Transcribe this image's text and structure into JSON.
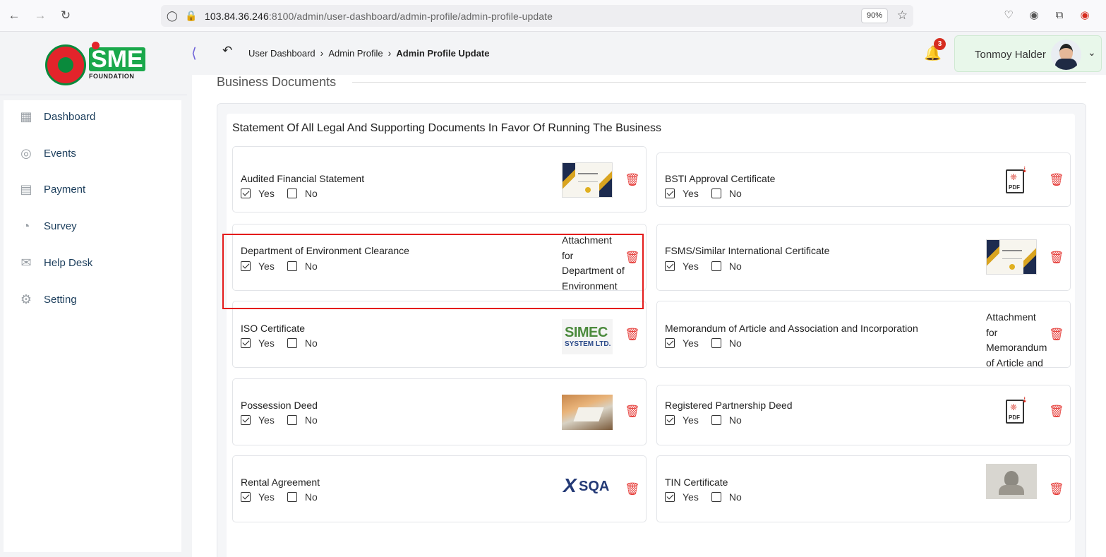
{
  "browser": {
    "url_host": "103.84.36.246",
    "url_rest": ":8100/admin/user-dashboard/admin-profile/admin-profile-update",
    "zoom": "90%"
  },
  "sidebar": {
    "logo_text": "SME",
    "logo_sub": "FOUNDATION",
    "items": [
      {
        "label": "Dashboard",
        "icon": "grid-icon"
      },
      {
        "label": "Events",
        "icon": "events-icon"
      },
      {
        "label": "Payment",
        "icon": "payment-icon"
      },
      {
        "label": "Survey",
        "icon": "pie-chart-icon"
      },
      {
        "label": "Help Desk",
        "icon": "mail-icon"
      },
      {
        "label": "Setting",
        "icon": "gear-icon"
      }
    ]
  },
  "header": {
    "breadcrumb": [
      "User Dashboard",
      "Admin Profile",
      "Admin Profile Update"
    ],
    "notification_count": "3",
    "user_name": "Tonmoy Halder"
  },
  "main": {
    "section_title": "Business Documents",
    "card_title": "Statement Of All Legal And Supporting Documents In Favor Of Running The Business",
    "yes_label": "Yes",
    "no_label": "No",
    "documents": [
      {
        "title": "Audited Financial Statement",
        "yes": true,
        "no": false,
        "attachment": "certificate-thumbnail"
      },
      {
        "title": "BSTI Approval Certificate",
        "yes": true,
        "no": false,
        "attachment": "pdf-icon"
      },
      {
        "title": "Department of Environment Clearance",
        "yes": true,
        "no": false,
        "attachment_alt": "Attachment for Department of Environment"
      },
      {
        "title": "FSMS/Similar International Certificate",
        "yes": true,
        "no": false,
        "attachment": "certificate-thumbnail"
      },
      {
        "title": "ISO Certificate",
        "yes": true,
        "no": false,
        "attachment": "simec-logo",
        "logo_t1": "SIMEC",
        "logo_t2": "SYSTEM LTD."
      },
      {
        "title": "Memorandum of Article and Association and Incorporation",
        "yes": true,
        "no": false,
        "attachment_alt": "Attachment for Memorandum of Article and"
      },
      {
        "title": "Possession Deed",
        "yes": true,
        "no": false,
        "attachment": "desk-photo"
      },
      {
        "title": "Registered Partnership Deed",
        "yes": true,
        "no": false,
        "attachment": "pdf-icon"
      },
      {
        "title": "Rental Agreement",
        "yes": true,
        "no": false,
        "attachment": "sqa-logo",
        "logo_text": "SQA"
      },
      {
        "title": "TIN Certificate",
        "yes": true,
        "no": false,
        "attachment": "statue-photo"
      }
    ],
    "pdf_label": "PDF"
  },
  "colors": {
    "accent_green": "#1aa84b",
    "danger_red": "#e53935",
    "highlight_red": "#e41b1b"
  }
}
